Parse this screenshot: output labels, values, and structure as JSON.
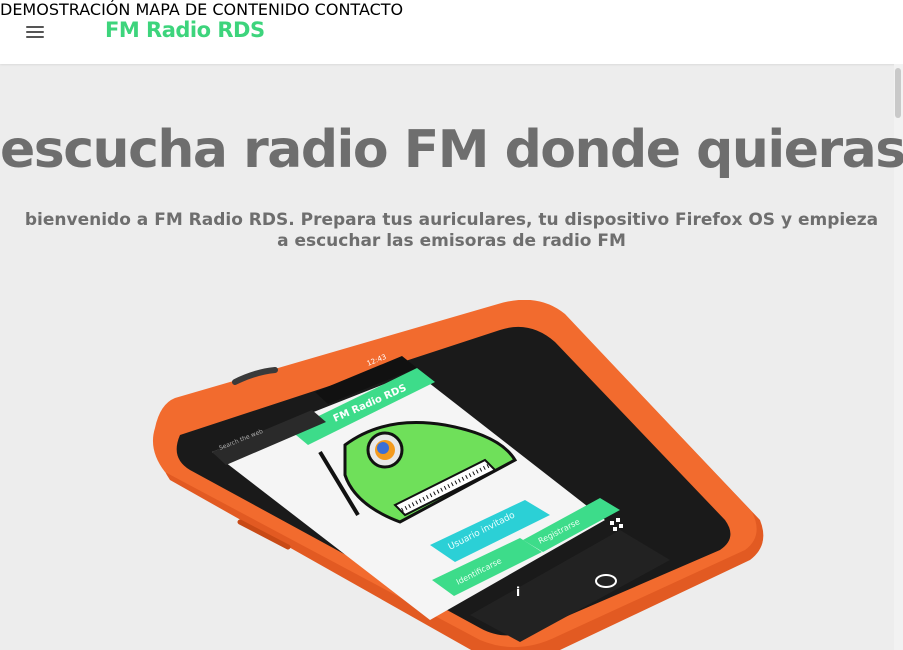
{
  "header": {
    "brand": "FM Radio RDS",
    "nav": [
      {
        "label": "DEMOSTRACIÓN"
      },
      {
        "label": "MAPA DE CONTENIDO"
      },
      {
        "label": "CONTACTO"
      }
    ]
  },
  "hero": {
    "title": "escucha radio FM donde quieras",
    "subtitle": "bienvenido a FM Radio RDS. Prepara tus auriculares, tu dispositivo Firefox OS y empieza a escuchar las emisoras de radio FM"
  },
  "phone_screen": {
    "status_time": "12:43",
    "search_placeholder": "Search the web",
    "app_title": "FM Radio RDS",
    "buttons": {
      "guest": "Usuario invitado",
      "register": "Registrarse",
      "login": "Identificarse"
    }
  },
  "colors": {
    "brand_green": "#3dd47c",
    "phone_orange": "#f26b2e",
    "button_cyan": "#2bd0d6",
    "button_green": "#3ddc8a"
  },
  "icons": [
    "menu-icon",
    "firefox-icon",
    "info-icon",
    "grid-icon",
    "home-icon"
  ]
}
